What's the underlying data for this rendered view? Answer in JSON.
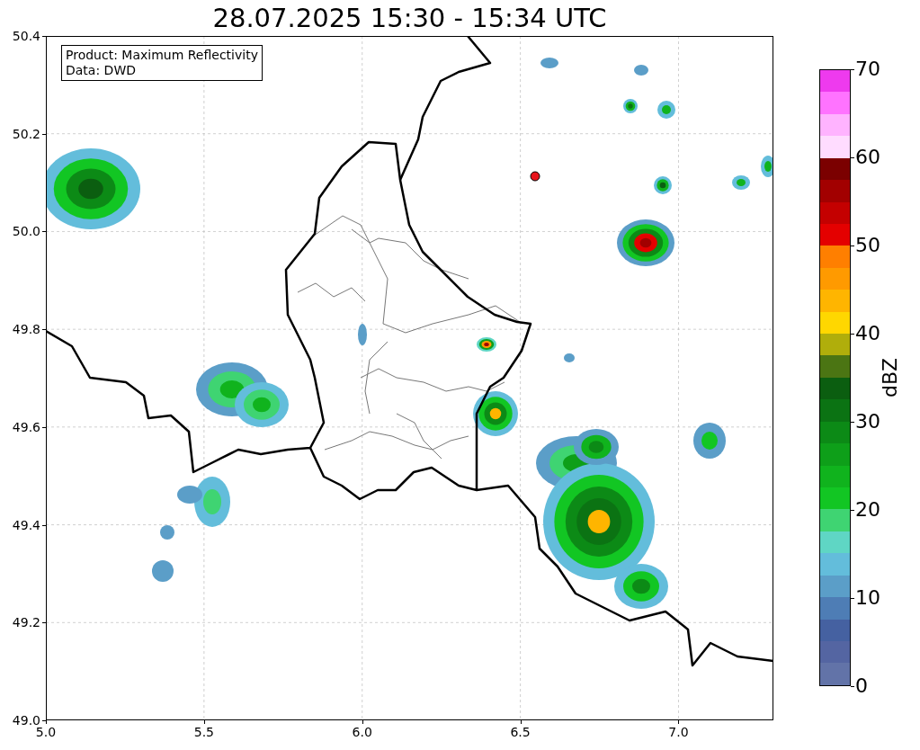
{
  "title": "28.07.2025 15:30 - 15:34 UTC",
  "map": {
    "info_lines": [
      "Product: Maximum Reflectivity",
      "Data: DWD"
    ],
    "xticks": [
      "5.0",
      "5.5",
      "6.0",
      "6.5",
      "7.0"
    ],
    "yticks": [
      "50.4",
      "50.2",
      "50.0",
      "49.8",
      "49.6",
      "49.4",
      "49.2",
      "49.0"
    ]
  },
  "colorbar": {
    "label": "dBZ",
    "ticks": [
      "70",
      "60",
      "50",
      "40",
      "30",
      "20",
      "10",
      "0"
    ],
    "bands": [
      {
        "color": "#ee3aee"
      },
      {
        "color": "#ff73ff"
      },
      {
        "color": "#ffb3ff"
      },
      {
        "color": "#ffdcff"
      },
      {
        "color": "#7b0000"
      },
      {
        "color": "#a20000"
      },
      {
        "color": "#c40000"
      },
      {
        "color": "#e40000"
      },
      {
        "color": "#ff7f00"
      },
      {
        "color": "#ff9a00"
      },
      {
        "color": "#ffb500"
      },
      {
        "color": "#ffd700"
      },
      {
        "color": "#b0ae0b"
      },
      {
        "color": "#4b7513"
      },
      {
        "color": "#0b5e10"
      },
      {
        "color": "#0b7313"
      },
      {
        "color": "#0c8a16"
      },
      {
        "color": "#0e9f19"
      },
      {
        "color": "#10b31d"
      },
      {
        "color": "#12c623"
      },
      {
        "color": "#3fd472"
      },
      {
        "color": "#5fd6c4"
      },
      {
        "color": "#63bddb"
      },
      {
        "color": "#5b9ec8"
      },
      {
        "color": "#4e7db5"
      },
      {
        "color": "#4561a1"
      },
      {
        "color": "#5465a2"
      },
      {
        "color": "#6273a8"
      }
    ]
  }
}
